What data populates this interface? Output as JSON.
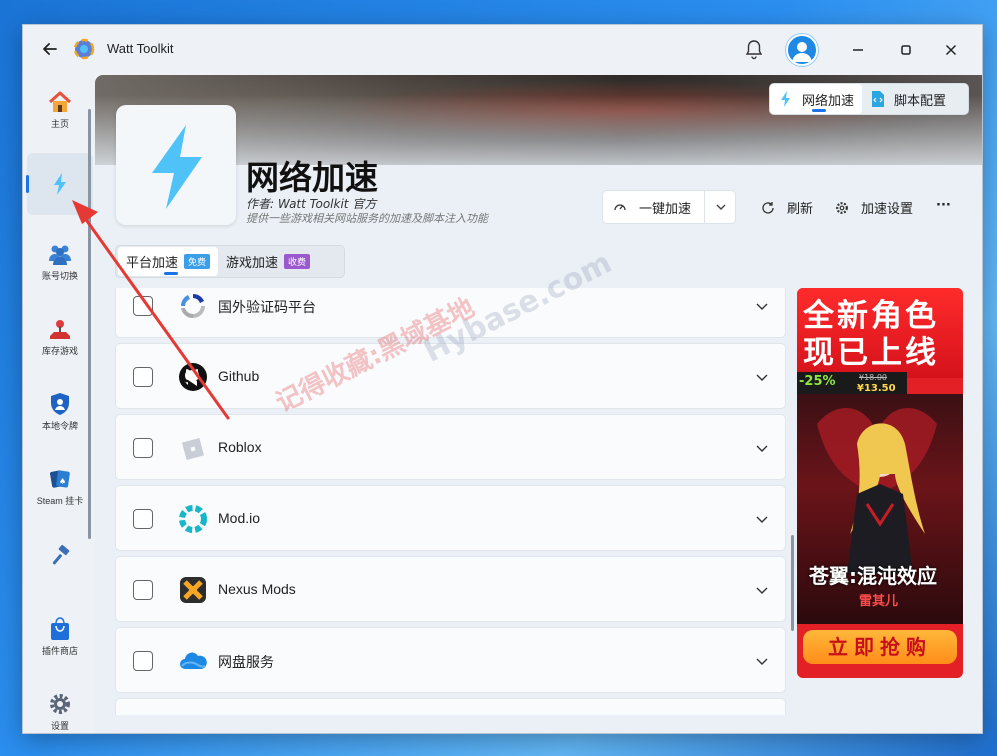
{
  "titlebar": {
    "back_icon": "arrow-left-icon",
    "app_name": "Watt Toolkit",
    "notification_icon": "bell-icon",
    "avatar_icon": "user-avatar-icon",
    "minimize": "—",
    "maximize": "▢",
    "close": "✕"
  },
  "sidebar": {
    "items": [
      {
        "label": "主页",
        "icon": "home-icon"
      },
      {
        "label": "",
        "icon": "lightning-icon"
      },
      {
        "label": "账号切换",
        "icon": "users-icon"
      },
      {
        "label": "库存游戏",
        "icon": "joystick-icon"
      },
      {
        "label": "本地令牌",
        "icon": "shield-user-icon"
      },
      {
        "label": "Steam 挂卡",
        "icon": "cards-icon"
      },
      {
        "label": "",
        "icon": "hammer-icon"
      },
      {
        "label": "插件商店",
        "icon": "shopping-bag-icon"
      },
      {
        "label": "设置",
        "icon": "gear-icon"
      }
    ],
    "active_index": 1
  },
  "header": {
    "title": "网络加速",
    "author": "作者:  Watt Toolkit  官方",
    "description": "提供一些游戏相关网站服务的加速及脚本注入功能"
  },
  "top_tabs": [
    {
      "label": "网络加速",
      "active": true
    },
    {
      "label": "脚本配置",
      "active": false
    }
  ],
  "actions": {
    "quick_accelerate": "一键加速",
    "refresh": "刷新",
    "accelerate_settings": "加速设置",
    "more": "···"
  },
  "category_tabs": [
    {
      "label": "平台加速",
      "badge": "免费",
      "active": true
    },
    {
      "label": "游戏加速",
      "badge": "收费",
      "active": false
    }
  ],
  "services": [
    {
      "name": "国外验证码平台",
      "icon": "recaptcha-icon",
      "checked": false
    },
    {
      "name": "Github",
      "icon": "github-icon",
      "checked": false
    },
    {
      "name": "Roblox",
      "icon": "roblox-icon",
      "checked": false
    },
    {
      "name": "Mod.io",
      "icon": "modio-icon",
      "checked": false
    },
    {
      "name": "Nexus Mods",
      "icon": "nexus-mods-icon",
      "checked": false
    },
    {
      "name": "网盘服务",
      "icon": "cloud-drive-icon",
      "checked": false
    }
  ],
  "ad": {
    "headline_1": "全新角色",
    "headline_2": "现已上线",
    "discount": "-25%",
    "old_price": "¥18.00",
    "new_price": "¥13.50",
    "game_title": "苍翼:混沌效应",
    "character": "雷其儿",
    "buy_button": "立即抢购"
  },
  "watermark": {
    "text_cn": "记得收藏:黑域基地",
    "text_en": "Hybase.com"
  },
  "colors": {
    "accent": "#1a73e8",
    "lightning": "#4fc3f7",
    "free_badge": "#3b9ee8",
    "paid_badge": "#9b59d0",
    "annotation_arrow": "#e53935"
  }
}
